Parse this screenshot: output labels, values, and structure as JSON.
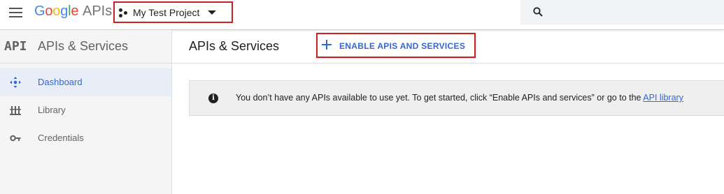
{
  "topbar": {
    "logo_letters": [
      {
        "char": "G",
        "color": "#4285F4"
      },
      {
        "char": "o",
        "color": "#EA4335"
      },
      {
        "char": "o",
        "color": "#FBBC05"
      },
      {
        "char": "g",
        "color": "#4285F4"
      },
      {
        "char": "l",
        "color": "#34A853"
      },
      {
        "char": "e",
        "color": "#EA4335"
      }
    ],
    "logo_suffix": "APIs",
    "project_name": "My Test Project",
    "menu_icon": "hamburger-menu-icon",
    "search_icon": "search-icon"
  },
  "sidebar": {
    "api_mark": "API",
    "title": "APIs & Services",
    "items": [
      {
        "label": "Dashboard",
        "icon": "dashboard-icon",
        "active": true
      },
      {
        "label": "Library",
        "icon": "library-icon",
        "active": false
      },
      {
        "label": "Credentials",
        "icon": "key-icon",
        "active": false
      }
    ]
  },
  "main": {
    "title": "APIs & Services",
    "enable_button_label": "ENABLE APIS AND SERVICES",
    "notice": {
      "text": "You don’t have any APIs available to use yet. To get started, click “Enable APIs and services” or go to the ",
      "link": "API library"
    }
  },
  "colors": {
    "accent": "#3367d6",
    "highlight_border": "#cc1f1f",
    "active_nav_bg": "#e8eef8"
  }
}
